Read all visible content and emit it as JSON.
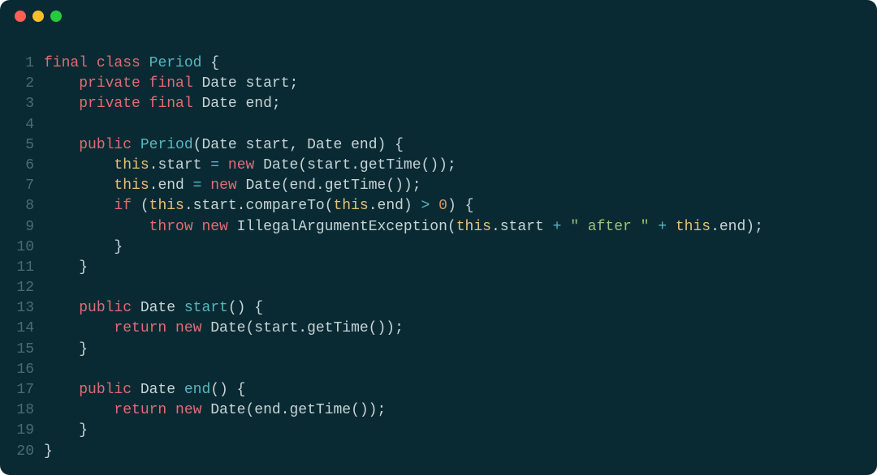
{
  "colors": {
    "background": "#0a2a33",
    "gutter": "#4a6b74",
    "default": "#c7d4d6",
    "keyword": "#e06c75",
    "type": "#56b6c2",
    "this": "#e5c07b",
    "string": "#98c379",
    "number": "#d19a66",
    "dotRed": "#ff5f56",
    "dotYellow": "#ffbd2e",
    "dotGreen": "#27c93f"
  },
  "lineCount": 20,
  "lines": [
    [
      [
        "kw",
        "final"
      ],
      [
        "def",
        " "
      ],
      [
        "kw",
        "class"
      ],
      [
        "def",
        " "
      ],
      [
        "type",
        "Period"
      ],
      [
        "def",
        " {"
      ]
    ],
    [
      [
        "def",
        "    "
      ],
      [
        "kw",
        "private"
      ],
      [
        "def",
        " "
      ],
      [
        "kw",
        "final"
      ],
      [
        "def",
        " Date start;"
      ]
    ],
    [
      [
        "def",
        "    "
      ],
      [
        "kw",
        "private"
      ],
      [
        "def",
        " "
      ],
      [
        "kw",
        "final"
      ],
      [
        "def",
        " Date end;"
      ]
    ],
    [],
    [
      [
        "def",
        "    "
      ],
      [
        "kw",
        "public"
      ],
      [
        "def",
        " "
      ],
      [
        "type",
        "Period"
      ],
      [
        "def",
        "(Date start, Date end) {"
      ]
    ],
    [
      [
        "def",
        "        "
      ],
      [
        "this",
        "this"
      ],
      [
        "def",
        ".start "
      ],
      [
        "op",
        "="
      ],
      [
        "def",
        " "
      ],
      [
        "kw",
        "new"
      ],
      [
        "def",
        " Date(start.getTime());"
      ]
    ],
    [
      [
        "def",
        "        "
      ],
      [
        "this",
        "this"
      ],
      [
        "def",
        ".end "
      ],
      [
        "op",
        "="
      ],
      [
        "def",
        " "
      ],
      [
        "kw",
        "new"
      ],
      [
        "def",
        " Date(end.getTime());"
      ]
    ],
    [
      [
        "def",
        "        "
      ],
      [
        "kw",
        "if"
      ],
      [
        "def",
        " ("
      ],
      [
        "this",
        "this"
      ],
      [
        "def",
        ".start.compareTo("
      ],
      [
        "this",
        "this"
      ],
      [
        "def",
        ".end) "
      ],
      [
        "op",
        ">"
      ],
      [
        "def",
        " "
      ],
      [
        "num",
        "0"
      ],
      [
        "def",
        ") {"
      ]
    ],
    [
      [
        "def",
        "            "
      ],
      [
        "kw",
        "throw"
      ],
      [
        "def",
        " "
      ],
      [
        "kw",
        "new"
      ],
      [
        "def",
        " IllegalArgumentException("
      ],
      [
        "this",
        "this"
      ],
      [
        "def",
        ".start "
      ],
      [
        "op",
        "+"
      ],
      [
        "def",
        " "
      ],
      [
        "str",
        "\" after \""
      ],
      [
        "def",
        " "
      ],
      [
        "op",
        "+"
      ],
      [
        "def",
        " "
      ],
      [
        "this",
        "this"
      ],
      [
        "def",
        ".end);"
      ]
    ],
    [
      [
        "def",
        "        }"
      ]
    ],
    [
      [
        "def",
        "    }"
      ]
    ],
    [],
    [
      [
        "def",
        "    "
      ],
      [
        "kw",
        "public"
      ],
      [
        "def",
        " Date "
      ],
      [
        "type",
        "start"
      ],
      [
        "def",
        "() {"
      ]
    ],
    [
      [
        "def",
        "        "
      ],
      [
        "kw",
        "return"
      ],
      [
        "def",
        " "
      ],
      [
        "kw",
        "new"
      ],
      [
        "def",
        " Date(start.getTime());"
      ]
    ],
    [
      [
        "def",
        "    }"
      ]
    ],
    [],
    [
      [
        "def",
        "    "
      ],
      [
        "kw",
        "public"
      ],
      [
        "def",
        " Date "
      ],
      [
        "type",
        "end"
      ],
      [
        "def",
        "() {"
      ]
    ],
    [
      [
        "def",
        "        "
      ],
      [
        "kw",
        "return"
      ],
      [
        "def",
        " "
      ],
      [
        "kw",
        "new"
      ],
      [
        "def",
        " Date(end.getTime());"
      ]
    ],
    [
      [
        "def",
        "    }"
      ]
    ],
    [
      [
        "def",
        "}"
      ]
    ]
  ]
}
